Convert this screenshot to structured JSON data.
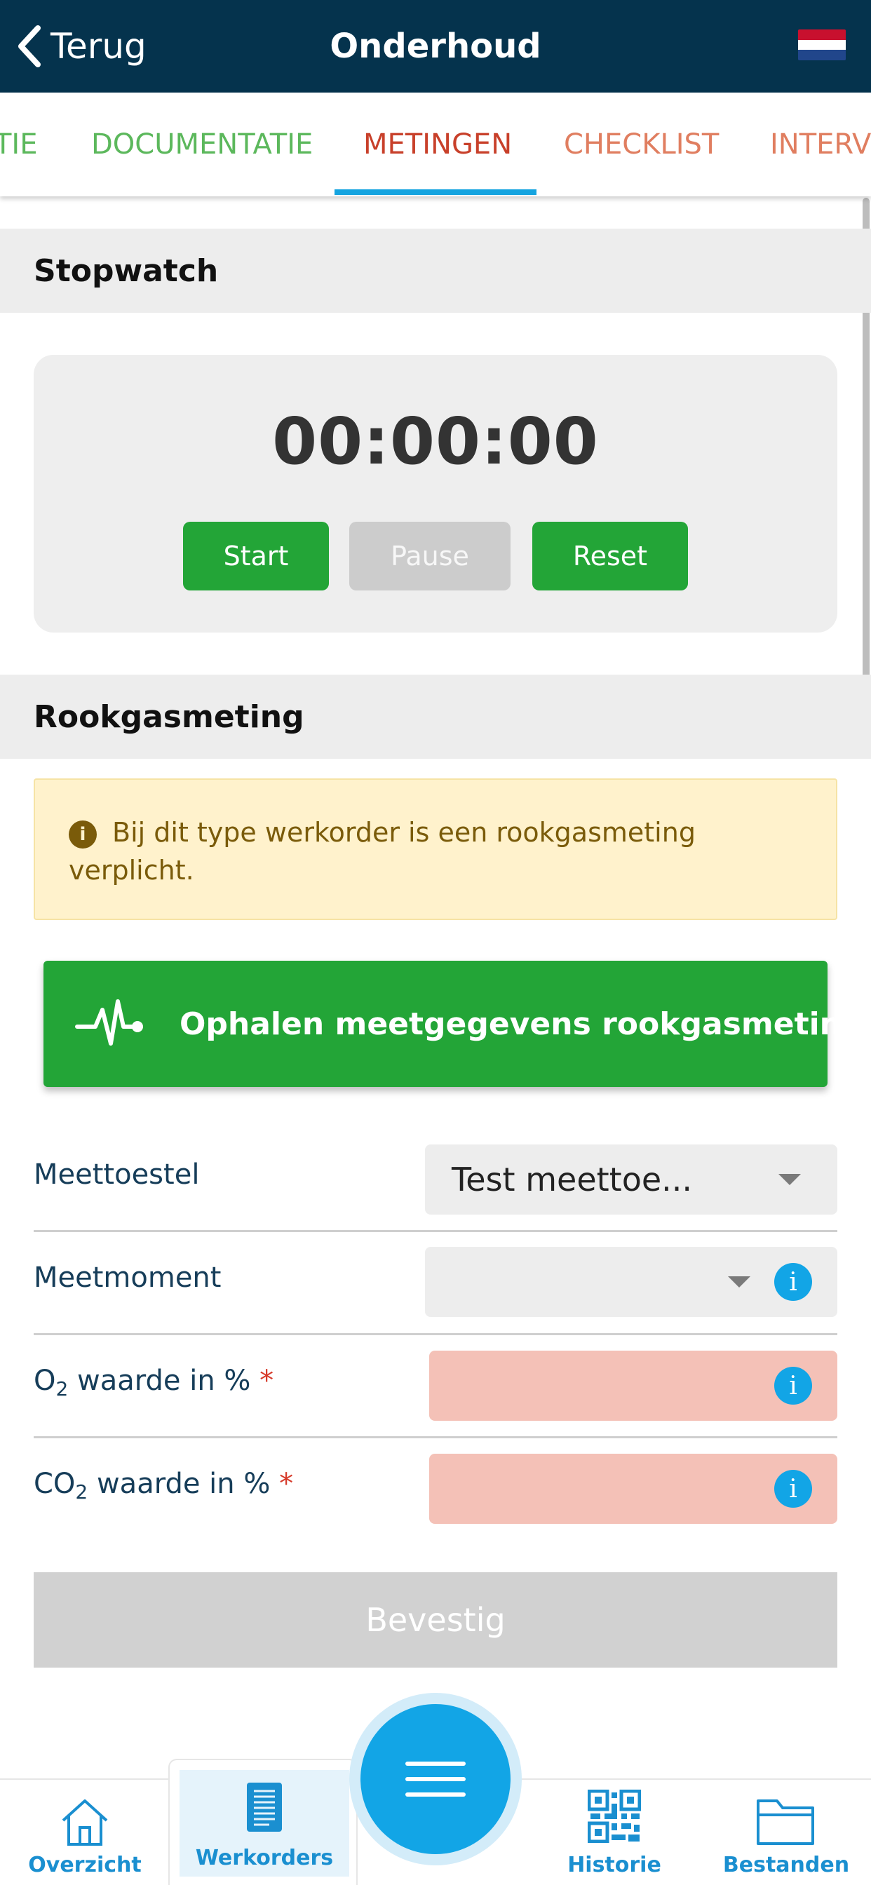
{
  "header": {
    "back_label": "Terug",
    "title": "Onderhoud",
    "language_flag": "dutch-flag",
    "colors": {
      "background": "#05334d",
      "text": "#ffffff"
    }
  },
  "tabs": {
    "items": [
      {
        "label": "TIE",
        "state": "visited",
        "color": "#5cb85c"
      },
      {
        "label": "DOCUMENTATIE",
        "state": "visited",
        "color": "#5cb85c"
      },
      {
        "label": "METINGEN",
        "state": "active",
        "color": "#c8402a"
      },
      {
        "label": "CHECKLIST",
        "state": "pending",
        "color": "#e07e60"
      },
      {
        "label": "INTERV",
        "state": "pending",
        "color": "#e07e60"
      }
    ],
    "active_indicator_color": "#15a4e0"
  },
  "stopwatch": {
    "heading": "Stopwatch",
    "time": "00:00:00",
    "start_label": "Start",
    "pause_label": "Pause",
    "reset_label": "Reset",
    "pause_enabled": false
  },
  "flue_gas": {
    "heading": "Rookgasmeting",
    "alert_text": "Bij dit type werkorder is een rookgasmeting verplicht.",
    "fetch_button_label": "Ophalen meetgegevens rookgasmeting",
    "fetch_icon": "heartbeat-icon",
    "fields": {
      "device": {
        "label": "Meettoestel",
        "value": "Test meettoe..."
      },
      "moment": {
        "label": "Meetmoment",
        "value": ""
      },
      "o2": {
        "label_prefix": "O",
        "label_sub": "2",
        "label_suffix": " waarde in %",
        "required_mark": "*",
        "value": ""
      },
      "co2": {
        "label_prefix": "CO",
        "label_sub": "2",
        "label_suffix": " waarde in %",
        "required_mark": "*",
        "value": ""
      }
    },
    "info_icon_glyph": "i",
    "confirm_label": "Bevestig"
  },
  "bottom_nav": {
    "items": [
      {
        "label": "Overzicht",
        "icon": "home-icon"
      },
      {
        "label": "Werkorders",
        "icon": "document-icon",
        "active": true
      },
      {
        "label": "Historie",
        "icon": "qr-code-icon"
      },
      {
        "label": "Bestanden",
        "icon": "folder-icon"
      }
    ],
    "menu_icon": "menu-icon",
    "accent": "#12a5e6"
  }
}
